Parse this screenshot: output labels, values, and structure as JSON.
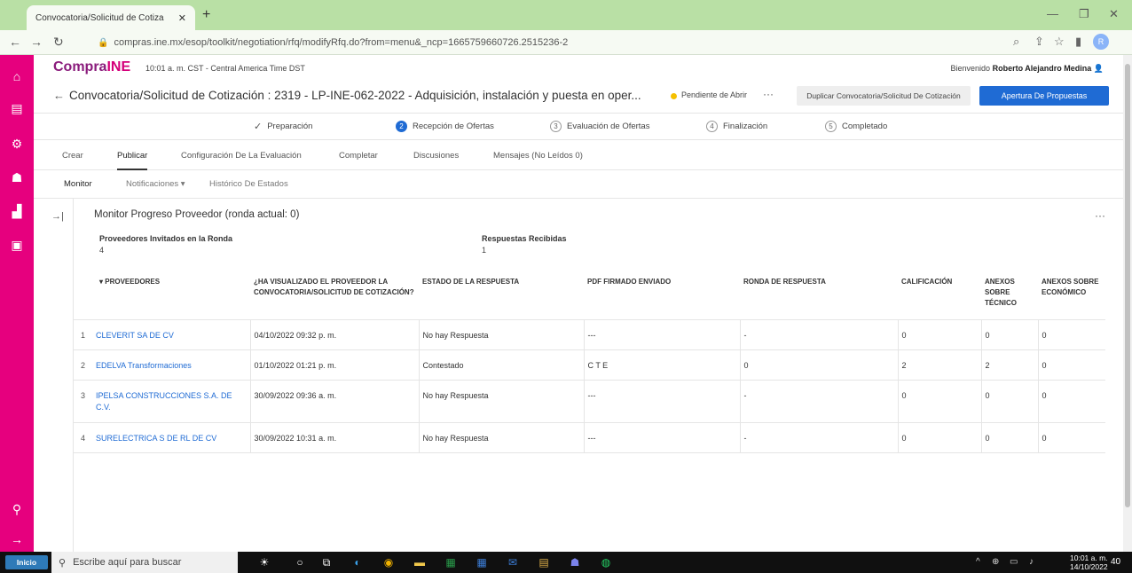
{
  "browser": {
    "tab_title": "Convocatoria/Solicitud de Cotiza",
    "tab_close": "✕",
    "new_tab": "+",
    "url": "compras.ine.mx/esop/toolkit/negotiation/rfq/modifyRfq.do?from=menu&_ncp=1665759660726.2515236-2",
    "profile_initial": "R",
    "minimize": "—",
    "restore": "❐",
    "close": "✕"
  },
  "header": {
    "logo_a": "Compra",
    "logo_b": "INE",
    "clock": "10:01 a. m. CST - Central America Time DST",
    "welcome": "Bienvenido",
    "user": "Roberto Alejandro Medina"
  },
  "title": {
    "text": "Convocatoria/Solicitud de Cotización : 2319 - LP-INE-062-2022 - Adquisición, instalación y puesta en oper...",
    "status": "Pendiente de Abrir",
    "more": "···",
    "dup_button": "Duplicar Convocatoria/Solicitud De Cotización",
    "open_button": "Apertura De Propuestas"
  },
  "steps": [
    {
      "n": "✓",
      "label": "Preparación"
    },
    {
      "n": "2",
      "label": "Recepción de Ofertas"
    },
    {
      "n": "3",
      "label": "Evaluación de Ofertas"
    },
    {
      "n": "4",
      "label": "Finalización"
    },
    {
      "n": "5",
      "label": "Completado"
    }
  ],
  "tabs": [
    "Crear",
    "Publicar",
    "Configuración De La Evaluación",
    "Completar",
    "Discusiones",
    "Mensajes (No Leídos 0)"
  ],
  "subtabs": [
    "Monitor",
    "Notificaciones ▾",
    "Histórico De Estados"
  ],
  "monitor": {
    "title": "Monitor Progreso Proveedor (ronda actual: 0)",
    "more": "···",
    "invited_label": "Proveedores Invitados en la Ronda",
    "invited_value": "4",
    "received_label": "Respuestas Recibidas",
    "received_value": "1"
  },
  "table": {
    "headers": [
      "▾ PROVEEDORES",
      "¿HA VISUALIZADO EL PROVEEDOR LA CONVOCATORIA/SOLICITUD DE COTIZACIÓN?",
      "ESTADO DE LA RESPUESTA",
      "PDF FIRMADO ENVIADO",
      "RONDA DE RESPUESTA",
      "CALIFICACIÓN",
      "ANEXOS SOBRE TÉCNICO",
      "ANEXOS SOBRE ECONÓMICO"
    ],
    "rows": [
      {
        "idx": "1",
        "name": "CLEVERIT SA DE CV",
        "viewed": "04/10/2022 09:32 p. m.",
        "estado": "No hay Respuesta",
        "pdf": "---",
        "ronda": "-",
        "calif": "0",
        "tec": "0",
        "eco": "0"
      },
      {
        "idx": "2",
        "name": "EDELVA Transformaciones",
        "viewed": "01/10/2022 01:21 p. m.",
        "estado": "Contestado",
        "pdf": "C T E",
        "ronda": "0",
        "calif": "2",
        "tec": "2",
        "eco": "0"
      },
      {
        "idx": "3",
        "name": "IPELSA CONSTRUCCIONES S.A. DE C.V.",
        "viewed": "30/09/2022 09:36 a. m.",
        "estado": "No hay Respuesta",
        "pdf": "---",
        "ronda": "-",
        "calif": "0",
        "tec": "0",
        "eco": "0"
      },
      {
        "idx": "4",
        "name": "SURELECTRICA S DE RL DE CV",
        "viewed": "30/09/2022 10:31 a. m.",
        "estado": "No hay Respuesta",
        "pdf": "---",
        "ronda": "-",
        "calif": "0",
        "tec": "0",
        "eco": "0"
      }
    ]
  },
  "taskbar": {
    "start": "Inicio",
    "search_placeholder": "Escribe aquí para buscar",
    "time": "10:01 a. m.",
    "date": "14/10/2022",
    "notif_count": "40"
  }
}
